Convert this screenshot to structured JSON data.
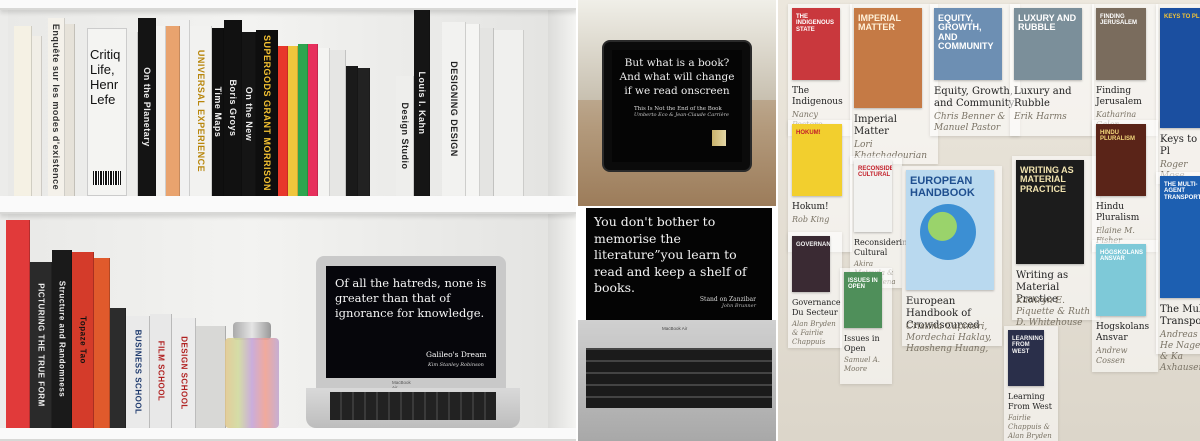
{
  "shelf_photo": {
    "book_spines": [
      {
        "label": "",
        "color": "#f5f1e4",
        "text_color": "#222"
      },
      {
        "label": "",
        "color": "#f1eee7",
        "text_color": "#222"
      },
      {
        "label": "Enquête sur les modes d'existence",
        "color": "#f4f1ea",
        "text_color": "#333"
      },
      {
        "label": "",
        "color": "#e6e2d9",
        "text_color": "#333"
      },
      {
        "label": "Critique of Everyday Life",
        "color": "#f4f4f2",
        "text_color": "#111"
      },
      {
        "label": "",
        "color": "#ededeb",
        "text_color": "#222"
      },
      {
        "label": "On the Planetary",
        "color": "#141414",
        "text_color": "#eee"
      },
      {
        "label": "",
        "color": "#f3f3f1",
        "text_color": "#222"
      },
      {
        "label": "",
        "color": "#e9a36e",
        "text_color": "#222"
      },
      {
        "label": "",
        "color": "#f1f1f1",
        "text_color": "#222"
      },
      {
        "label": "UNIVERSAL EXPERIENCE",
        "color": "#f2f2f0",
        "text_color": "#b8860b"
      },
      {
        "label": "Time Maps",
        "color": "#101010",
        "text_color": "#eee"
      },
      {
        "label": "Boris Groys",
        "color": "#111111",
        "text_color": "#eee"
      },
      {
        "label": "On the New",
        "color": "#151515",
        "text_color": "#eee"
      },
      {
        "label": "SUPERGODS GRANT MORRISON",
        "color": "#0e0e0e",
        "text_color": "#f4c233"
      },
      {
        "label": "",
        "color": "#e8372b",
        "text_color": "#111"
      },
      {
        "label": "",
        "color": "#f0c63c",
        "text_color": "#111"
      },
      {
        "label": "",
        "color": "#2ea54f",
        "text_color": "#111"
      },
      {
        "label": "",
        "color": "#e7305d",
        "text_color": "#111"
      },
      {
        "label": "",
        "color": "#f4f4f2",
        "text_color": "#111"
      },
      {
        "label": "",
        "color": "#e6e6e4",
        "text_color": "#111"
      },
      {
        "label": "",
        "color": "#1a1a1a",
        "text_color": "#eee"
      },
      {
        "label": "",
        "color": "#222222",
        "text_color": "#eee"
      },
      {
        "label": "Design Studio",
        "color": "#eeeeec",
        "text_color": "#222"
      },
      {
        "label": "Louis I. Kahn",
        "color": "#151515",
        "text_color": "#eee"
      },
      {
        "label": "DESIGNING DESIGN",
        "color": "#f2f2f0",
        "text_color": "#222"
      },
      {
        "label": "",
        "color": "#f5f5f3",
        "text_color": "#222"
      },
      {
        "label": "",
        "color": "#e4e4e2",
        "text_color": "#222"
      },
      {
        "label": "",
        "color": "#f0f0ee",
        "text_color": "#222"
      }
    ],
    "cover_book_title": "Critiq\nLife,\nHenr\nLefe",
    "lower_spines": [
      {
        "label": "",
        "color": "#e13a3a",
        "text_color": "#fff"
      },
      {
        "label": "PICTURING THE TRUE FORM",
        "color": "#2a2a2a",
        "text_color": "#eee"
      },
      {
        "label": "Structure and Randomness",
        "color": "#1a1a1a",
        "text_color": "#eee"
      },
      {
        "label": "Topaze Tao",
        "color": "#d43b2a",
        "text_color": "#111"
      },
      {
        "label": "",
        "color": "#e05a2c",
        "text_color": "#111"
      },
      {
        "label": "",
        "color": "#2c2c2c",
        "text_color": "#eee"
      },
      {
        "label": "BUSINESS SCHOOL",
        "color": "#eaeaea",
        "text_color": "#1e3a6e"
      },
      {
        "label": "FILM SCHOOL",
        "color": "#e8e8e8",
        "text_color": "#b02020"
      },
      {
        "label": "DESIGN SCHOOL",
        "color": "#ececec",
        "text_color": "#b02020"
      },
      {
        "label": "",
        "color": "#d8d8d6",
        "text_color": "#111"
      }
    ],
    "laptop_quote": "Of all the hatreds, none is greater than that of ignorance for knowledge.",
    "laptop_attrib_title": "Galileo's Dream",
    "laptop_attrib_author": "Kim Stanley Robinson",
    "laptop_brand": "MacBook Air"
  },
  "tablet_photo": {
    "quote": "But what is a book? And what will change if we read onscreen",
    "attrib_title": "This Is Not the End of the Book",
    "attrib_author": "Umberto Eco & Jean-Claude Carrière"
  },
  "laptop_photo": {
    "quote": "You don't bother to memorise the literature”you learn to read and keep a shelf of books.",
    "attrib_title": "Stand on Zanzibar",
    "attrib_author": "John Brunner",
    "brand": "MacBook Air"
  },
  "digital_shelf": {
    "background": "#e6e1d6",
    "books": [
      {
        "title": "The Indigenous",
        "author": "Nancy Postero",
        "cover_text": "The Indigenous State",
        "cover_color": "#c9383d",
        "cover_text_color": "#ffffff"
      },
      {
        "title": "Imperial Matter",
        "author": "Lori Khatchadourian",
        "cover_text": "Imperial Matter",
        "cover_color": "#c57a45",
        "cover_text_color": "#fff1d8"
      },
      {
        "title": "Equity, Growth, and Community",
        "author": "Chris Benner & Manuel Pastor",
        "cover_text": "Equity, Growth, and Community",
        "cover_color": "#6d8fb3",
        "cover_text_color": "#ffffff"
      },
      {
        "title": "Luxury and Rubble",
        "author": "Erik Harms",
        "cover_text": "Luxury and Rubble",
        "cover_color": "#7b8f9a",
        "cover_text_color": "#ffffff"
      },
      {
        "title": "Finding Jerusalem",
        "author": "Katharina Galor",
        "cover_text": "Finding Jerusalem",
        "cover_color": "#7a6c5d",
        "cover_text_color": "#ffffff"
      },
      {
        "title": "Keys to Pl",
        "author": "Roger Mose",
        "cover_text": "Keys to Pl",
        "cover_color": "#1b4fa0",
        "cover_text_color": "#f3c436"
      },
      {
        "title": "Hokum!",
        "author": "Rob King",
        "cover_text": "Hokum!",
        "cover_color": "#f2cf2e",
        "cover_text_color": "#c3202a"
      },
      {
        "title": "Reconsidering Cultural",
        "author": "Akira Matsuda & Luisa Elena",
        "cover_text": "Reconsidering Cultural",
        "cover_color": "#f2f2f0",
        "cover_text_color": "#c3202a"
      },
      {
        "title": "European Handbook of Crowdsourced",
        "author": "Cristina Capineri, Mordechai Haklay, Haosheng Huang,",
        "cover_text": "European Handbook",
        "cover_color": "#b9d9ef",
        "cover_text_color": "#1f4f8f"
      },
      {
        "title": "Writing as Material Practice",
        "author": "Kathryn E. Piquette & Ruth D. Whitehouse",
        "cover_text": "Writing as Material Practice",
        "cover_color": "#1c1c1c",
        "cover_text_color": "#f2e4b0"
      },
      {
        "title": "Hindu Pluralism",
        "author": "Elaine M. Fisher",
        "cover_text": "Hindu Pluralism",
        "cover_color": "#5a2418",
        "cover_text_color": "#f1d57a"
      },
      {
        "title": "Governance Du Secteur",
        "author": "Alan Bryden & Fairlie Chappuis",
        "cover_text": "Governance",
        "cover_color": "#3a2a33",
        "cover_text_color": "#f1f1f1"
      },
      {
        "title": "Issues in Open",
        "author": "Samuel A. Moore",
        "cover_text": "Issues in Open",
        "cover_color": "#4f8f5a",
        "cover_text_color": "#ffffff"
      },
      {
        "title": "Hogskolans Ansvar",
        "author": "Andrew Cossen",
        "cover_text": "Högskolans Ansvar",
        "cover_color": "#7ec9d8",
        "cover_text_color": "#ffffff"
      },
      {
        "title": "The Multi Transport",
        "author": "Andreas He Nagel & Ka Axhausen",
        "cover_text": "The Multi-Agent Transport",
        "cover_color": "#1d5fb1",
        "cover_text_color": "#ffffff"
      },
      {
        "title": "Learning From West",
        "author": "Fairlie Chappuis & Alan Bryden",
        "cover_text": "Learning from West",
        "cover_color": "#2a2f4a",
        "cover_text_color": "#f1f1f1"
      }
    ]
  }
}
